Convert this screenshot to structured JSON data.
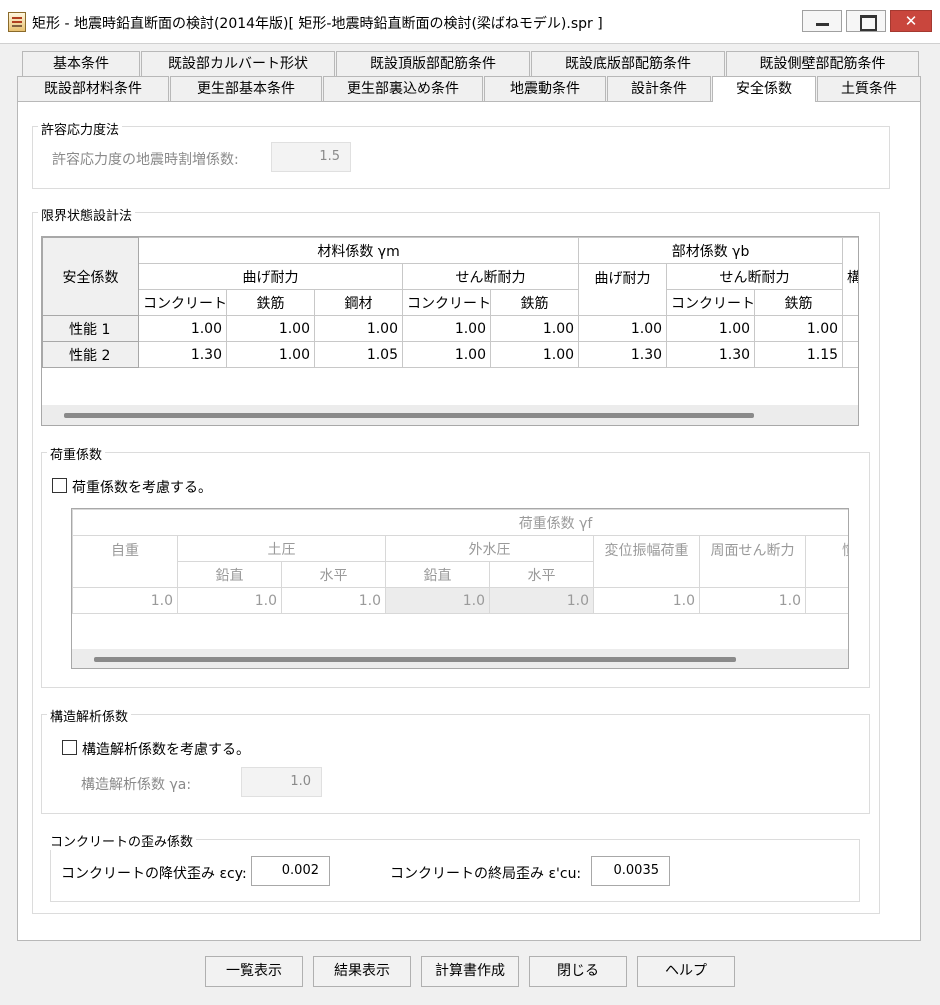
{
  "window": {
    "title": "矩形 - 地震時鉛直断面の検討(2014年版)[ 矩形-地震時鉛直断面の検討(梁ばねモデル).spr ]",
    "close_glyph": "✕"
  },
  "tabs_row1": [
    "基本条件",
    "既設部カルバート形状",
    "既設頂版部配筋条件",
    "既設底版部配筋条件",
    "既設側壁部配筋条件"
  ],
  "tabs_row2": [
    "既設部材料条件",
    "更生部基本条件",
    "更生部裏込め条件",
    "地震動条件",
    "設計条件",
    "安全係数",
    "土質条件"
  ],
  "active_tab": "安全係数",
  "allowable": {
    "group_label": "許容応力度法",
    "factor_label": "許容応力度の地震時割増係数:",
    "factor_value": "1.5"
  },
  "limit_state": {
    "group_label": "限界状態設計法",
    "headers": {
      "safety": "安全係数",
      "material": "材料係数 γm",
      "member": "部材係数 γb",
      "next_partial": "構",
      "bending": "曲げ耐力",
      "shear": "せん断耐力",
      "member_bending": "曲げ耐力",
      "member_shear": "せん断耐力",
      "concrete": "コンクリート",
      "rebar": "鉄筋",
      "steel": "鋼材",
      "shear_concrete": "コンクリート",
      "shear_rebar": "鉄筋",
      "m_concrete": "コンクリート",
      "m_rebar": "鉄筋"
    },
    "rows": [
      {
        "label": "性能 1",
        "values": [
          "1.00",
          "1.00",
          "1.00",
          "1.00",
          "1.00",
          "1.00",
          "1.00",
          "1.00"
        ]
      },
      {
        "label": "性能 2",
        "values": [
          "1.30",
          "1.00",
          "1.05",
          "1.00",
          "1.00",
          "1.30",
          "1.30",
          "1.15"
        ]
      }
    ]
  },
  "load_factor": {
    "group_label": "荷重係数",
    "checkbox_label": "荷重係数を考慮する。",
    "checked": false,
    "headers": {
      "top": "荷重係数 γf",
      "self_weight": "自重",
      "earth_pressure": "土圧",
      "external_water": "外水圧",
      "displacement": "変位振幅荷重",
      "perimeter_shear": "周面せん断力",
      "inertia_partial": "慣",
      "ep_vertical": "鉛直",
      "ep_horizontal": "水平",
      "ew_vertical": "鉛直",
      "ew_horizontal": "水平"
    },
    "values": [
      "1.0",
      "1.0",
      "1.0",
      "1.0",
      "1.0",
      "1.0",
      "1.0"
    ]
  },
  "structural": {
    "group_label": "構造解析係数",
    "checkbox_label": "構造解析係数を考慮する。",
    "checked": false,
    "factor_label": "構造解析係数 γa:",
    "factor_value": "1.0"
  },
  "strain": {
    "group_label": "コンクリートの歪み係数",
    "yield_label": "コンクリートの降伏歪み εcy:",
    "yield_value": "0.002",
    "ultimate_label": "コンクリートの終局歪み ε'cu:",
    "ultimate_value": "0.0035"
  },
  "buttons": {
    "list": "一覧表示",
    "result": "結果表示",
    "report": "計算書作成",
    "close": "閉じる",
    "help": "ヘルプ"
  }
}
